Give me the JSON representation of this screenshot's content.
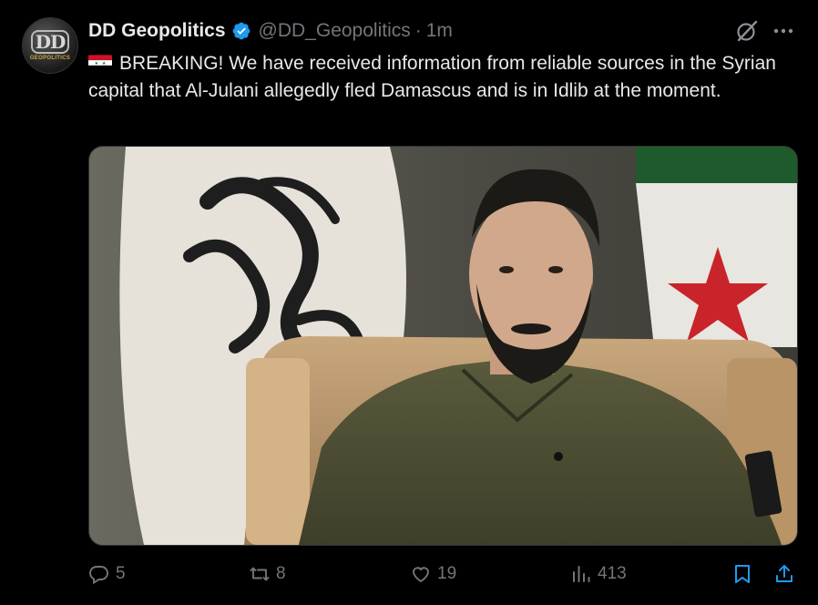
{
  "tweet": {
    "display_name": "DD Geopolitics",
    "handle": "@DD_Geopolitics",
    "separator": "·",
    "time": "1m",
    "text": "BREAKING! We have received information from reliable sources in the Syrian capital that Al-Julani allegedly fled Damascus and is in Idlib at the moment.",
    "avatar": {
      "monogram": "DD",
      "subtitle": "GEOPOLITICS"
    },
    "flag_emoji": "syria-flag-icon",
    "media": {
      "icon": "photo",
      "description_visible": false
    }
  },
  "actions": {
    "replies": "5",
    "reposts": "8",
    "likes": "19",
    "views": "413"
  },
  "icons": {
    "verified": "verified-badge-icon",
    "grok": "grok-icon",
    "more": "more-icon",
    "reply": "reply-icon",
    "repost": "repost-icon",
    "like": "like-icon",
    "views": "views-icon",
    "bookmark": "bookmark-icon",
    "share": "share-icon"
  },
  "colors": {
    "background": "#000000",
    "primary_text": "#e7e9ea",
    "secondary_text": "#71767b",
    "verified_blue": "#1d9bf0"
  }
}
